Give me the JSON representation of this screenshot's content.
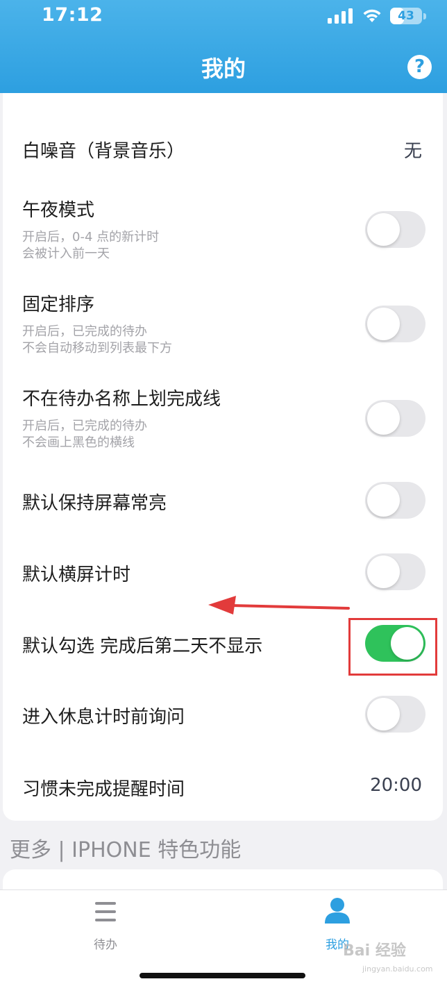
{
  "status_bar": {
    "time": "17:12",
    "battery": "43",
    "battery_level": 0.43
  },
  "header": {
    "title": "我的",
    "help_icon": "?"
  },
  "settings": [
    {
      "label": "白噪音（背景音乐）",
      "value": "无"
    },
    {
      "label": "午夜模式",
      "desc1": "开启后，0-4 点的新计时",
      "desc2": "会被计入前一天",
      "toggle": false
    },
    {
      "label": "固定排序",
      "desc1": "开启后，已完成的待办",
      "desc2": "不会自动移动到列表最下方",
      "toggle": false
    },
    {
      "label": "不在待办名称上划完成线",
      "desc1": "开启后，已完成的待办",
      "desc2": "不会画上黑色的横线",
      "toggle": false
    },
    {
      "label": "默认保持屏幕常亮",
      "toggle": false
    },
    {
      "label": "默认横屏计时",
      "toggle": false
    },
    {
      "label": "默认勾选 完成后第二天不显示",
      "toggle": true
    },
    {
      "label": "进入休息计时前询问",
      "toggle": false
    },
    {
      "label": "习惯未完成提醒时间",
      "value": "20:00"
    }
  ],
  "section": {
    "title": "更多 | IPHONE 特色功能"
  },
  "tabs": [
    {
      "label": "待办",
      "icon": "list-icon",
      "active": false
    },
    {
      "label": "我的",
      "icon": "person-icon",
      "active": true
    }
  ],
  "watermark": {
    "text": "Bai 经验",
    "sub": "jingyan.baidu.com"
  },
  "colors": {
    "header": "#2d9fe0",
    "toggle_on": "#2fc25b",
    "annotation": "#e23b3b",
    "tab_active": "#2d9fe0",
    "tab_inactive": "#8e8e93"
  }
}
